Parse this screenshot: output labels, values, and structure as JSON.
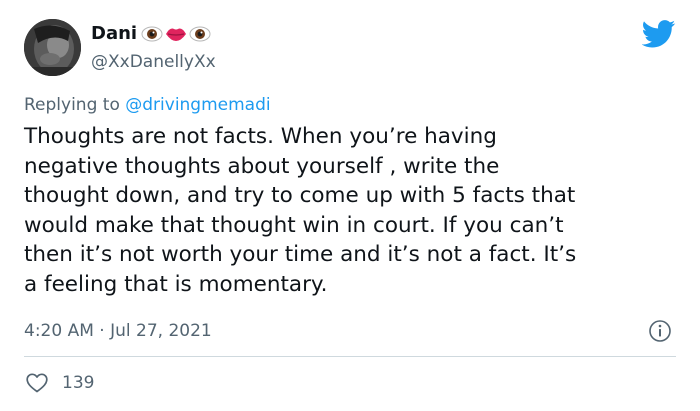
{
  "author": {
    "display_name": "Dani",
    "handle": "@XxDanellyXx",
    "name_emojis": [
      "eye-emoji",
      "lips-emoji",
      "eye-emoji"
    ]
  },
  "reply": {
    "prefix": "Replying to ",
    "mention": "@drivingmemadi"
  },
  "tweet": {
    "lines": [
      "Thoughts are not facts. When you’re having",
      "negative thoughts about yourself , write the",
      "thought down, and try to come up with 5 facts that",
      "would make that thought win in court. If you can’t",
      "then it’s not worth your time and it’s not a fact. It’s",
      "a feeling that is momentary."
    ],
    "time": "4:20 AM",
    "separator": " · ",
    "date": "Jul 27, 2021"
  },
  "engagement": {
    "likes": "139"
  },
  "icons": {
    "brand": "twitter-bird-icon",
    "info": "info-icon",
    "like": "heart-icon"
  },
  "colors": {
    "brand": "#1d9bf0",
    "text": "#0f1419",
    "secondary": "#536471",
    "divider": "#cfd9de"
  }
}
